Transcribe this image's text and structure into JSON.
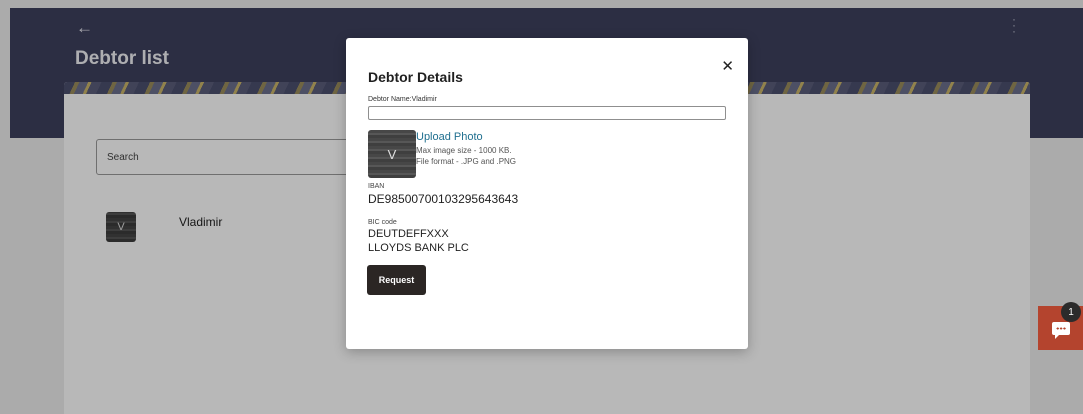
{
  "header": {
    "back_icon": "back-arrow-icon",
    "title": "Debtor list",
    "menu_icon": "kebab-menu-icon"
  },
  "search": {
    "label": "Search"
  },
  "debtors": [
    {
      "initial": "V",
      "name": "Vladimir"
    }
  ],
  "modal": {
    "title": "Debtor Details",
    "close_icon": "close-icon",
    "name_label": "Debtor Name:Vladimir",
    "name_value": "",
    "photo_initial": "V",
    "upload_label": "Upload Photo",
    "upload_hint_size": "Max image size - 1000 KB.",
    "upload_hint_format": "File format - .JPG and .PNG",
    "iban_label": "IBAN",
    "iban_value": "DE98500700103295643643",
    "bic_label": "BIC code",
    "bic_value": "DEUTDEFFXXX",
    "bank_name": "LLOYDS BANK PLC",
    "request_label": "Request"
  },
  "chat": {
    "icon": "chat-icon",
    "badge_count": "1"
  },
  "colors": {
    "header_bg": "#3d405e",
    "link": "#1f6f8f",
    "primary_button": "#2b2624",
    "chat_widget": "#b4442e"
  }
}
